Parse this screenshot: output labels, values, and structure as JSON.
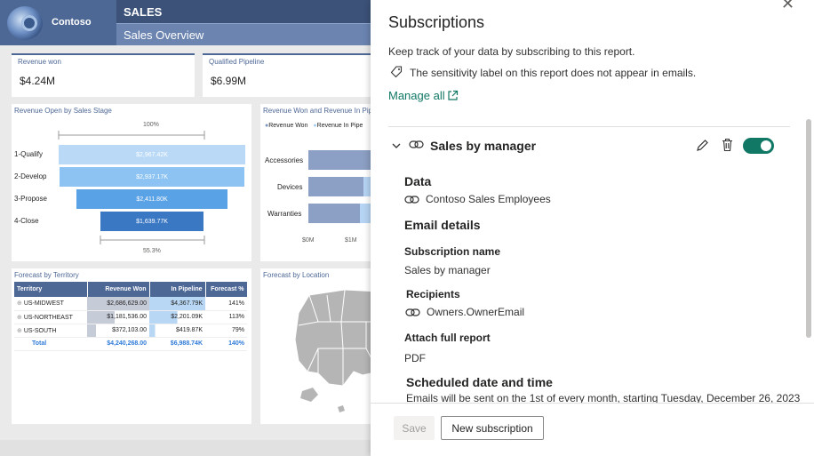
{
  "report": {
    "logo_text": "Contoso",
    "header_title": "SALES",
    "header_subtitle": "Sales Overview",
    "kpis": [
      {
        "label": "Revenue won",
        "value": "$4.24M"
      },
      {
        "label": "Qualified Pipeline",
        "value": "$6.99M"
      }
    ],
    "funnel": {
      "title": "Revenue Open by Sales Stage",
      "top_pct": "100%",
      "bottom_pct": "55.3%",
      "stages": [
        {
          "label": "1-Qualify",
          "value": "$2,967.42K"
        },
        {
          "label": "2-Develop",
          "value": "$2,937.17K"
        },
        {
          "label": "3-Propose",
          "value": "$2,411.80K"
        },
        {
          "label": "4-Close",
          "value": "$1,639.77K"
        }
      ]
    },
    "bar_chart": {
      "title": "Revenue Won and Revenue In Pipeline by Category",
      "legend": [
        "Revenue Won",
        "Revenue In Pipe"
      ],
      "categories": [
        "Accessories",
        "Devices",
        "Warranties"
      ],
      "ticks": [
        "$0M",
        "$1M"
      ]
    },
    "table": {
      "title": "Forecast by Territory",
      "columns": [
        "Territory",
        "Revenue Won",
        "In Pipeline",
        "Forecast %"
      ],
      "rows": [
        {
          "territory": "US-MIDWEST",
          "won": "$2,686,629.00",
          "pipe": "$4,367.79K",
          "pct": "141%"
        },
        {
          "territory": "US-NORTHEAST",
          "won": "$1,181,536.00",
          "pipe": "$2,201.09K",
          "pct": "113%"
        },
        {
          "territory": "US-SOUTH",
          "won": "$372,103.00",
          "pipe": "$419.87K",
          "pct": "79%"
        }
      ],
      "total": {
        "territory": "Total",
        "won": "$4,240,268.00",
        "pipe": "$6,988.74K",
        "pct": "140%"
      }
    },
    "map": {
      "title": "Forecast by Location"
    }
  },
  "pane": {
    "title": "Subscriptions",
    "description": "Keep track of your data by subscribing to this report.",
    "sensitivity_note": "The sensitivity label on this report does not appear in emails.",
    "manage_all": "Manage all",
    "subscription": {
      "name": "Sales by manager",
      "enabled": true,
      "data_heading": "Data",
      "data_source": "Contoso Sales Employees",
      "email_heading": "Email details",
      "sub_name_label": "Subscription name",
      "sub_name_value": "Sales by manager",
      "recipients_label": "Recipients",
      "recipients_value": "Owners.OwnerEmail",
      "attach_label": "Attach full report",
      "attach_value": "PDF",
      "schedule_heading": "Scheduled date and time",
      "schedule_text": "Emails will be sent on the 1st of every month, starting Tuesday, December 26, 2023"
    },
    "buttons": {
      "save": "Save",
      "new": "New subscription"
    }
  },
  "colors": {
    "accent": "#117865",
    "header": "#4e6896",
    "header_dark": "#3c5279"
  }
}
